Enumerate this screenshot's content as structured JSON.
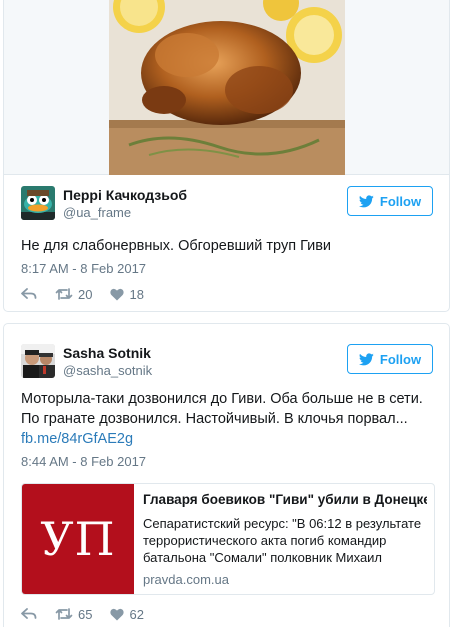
{
  "tweets": [
    {
      "author_name": "Перрі Качкодзьоб",
      "author_handle": "@ua_frame",
      "follow_label": "Follow",
      "text": "Не для слабонервных. Обгоревший труп Гиви",
      "timestamp": "8:17 AM - 8 Feb 2017",
      "retweets": "20",
      "likes": "18",
      "media_icon": "roast-chicken-photo"
    },
    {
      "author_name": "Sasha Sotnik",
      "author_handle": "@sasha_sotnik",
      "follow_label": "Follow",
      "text": "Моторыла-таки дозвонился до Гиви. Оба больше не в сети. По гранате дозвонился. Настойчивый. В клочья порвал...",
      "link": "fb.me/84rGfAE2g",
      "timestamp": "8:44 AM - 8 Feb 2017",
      "retweets": "65",
      "likes": "62",
      "card": {
        "thumb_text": "УП",
        "title": "Главаря боевиков \"Гиви\" убили в Донецке",
        "description": "Сепаратистский ресурс: \"В 06:12 в результате террористического акта погиб командир батальона \"Сомали\" полковник Михаил",
        "domain": "pravda.com.ua"
      }
    }
  ],
  "colors": {
    "accent": "#1da1f2",
    "link": "#2b7bb9",
    "muted": "#657786",
    "border": "#e1e8ed",
    "card_thumb": "#b30f1c"
  },
  "icons": [
    "reply-icon",
    "retweet-icon",
    "like-icon",
    "twitter-bird-icon"
  ]
}
